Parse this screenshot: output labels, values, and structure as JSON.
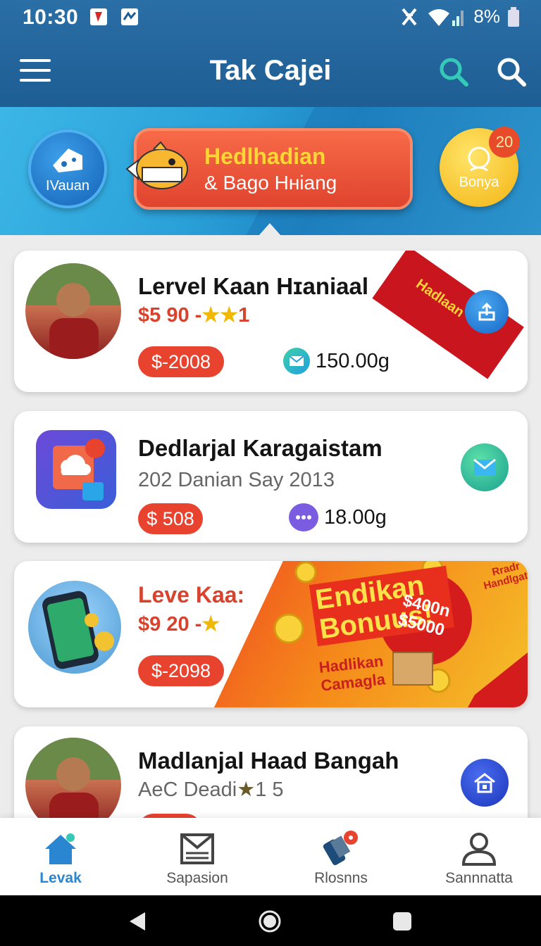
{
  "status_bar": {
    "time": "10:30",
    "battery": "8%"
  },
  "header": {
    "title": "Tak Cajei"
  },
  "promo": {
    "left_bubble": "IVauan",
    "headline": "Hedlhadian",
    "subline": "& Bago Hніang",
    "right_bubble": "Bonya",
    "right_badge": "20"
  },
  "cards": [
    {
      "title": "Lervel Kaan Hɪaniaal",
      "subtitle": "$5 90 -",
      "rating": "1",
      "price_pill": "$-2008",
      "metric": "150.00g",
      "ribbon": "Hadlaan"
    },
    {
      "title": "Dedlarjal Karagaistam",
      "subtitle": "202 Danian Say 2013",
      "price_pill": "$ 508",
      "metric": "18.00g"
    },
    {
      "title": "Leve Kaa:",
      "subtitle": "$9 20 -",
      "price_pill": "$-2098",
      "banner": {
        "headline1": "Endikan",
        "headline2": "Bonuus!",
        "sub1": "Hadlikan",
        "sub2": "Camagla",
        "burst1": "$400n",
        "burst2": "$5000",
        "tag1": "Rradr",
        "tag2": "Handlgata"
      }
    },
    {
      "title": "Madlanjal Haad Bangah",
      "subtitle": "AeC Deadi",
      "rating": "1 5"
    }
  ],
  "bottom_nav": [
    {
      "label": "Levak",
      "active": true
    },
    {
      "label": "Sapasion",
      "active": false
    },
    {
      "label": "Rlosnns",
      "active": false
    },
    {
      "label": "Sannnatta",
      "active": false
    }
  ],
  "colors": {
    "primary": "#1d5d93",
    "accent": "#e8432f",
    "active_nav": "#2a86d0"
  }
}
